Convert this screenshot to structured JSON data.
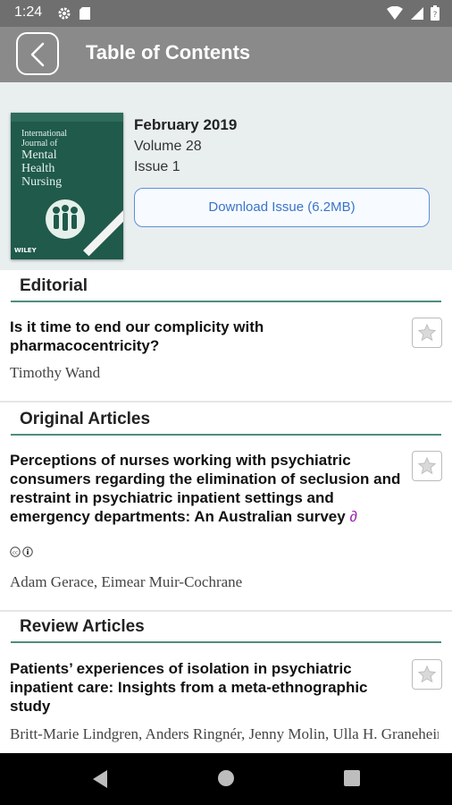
{
  "status_bar": {
    "time": "1:24",
    "left_icons": [
      "gear-icon",
      "sd-card-icon"
    ],
    "right_icons": [
      "wifi-icon",
      "signal-icon",
      "battery-icon"
    ]
  },
  "app_bar": {
    "title": "Table of Contents",
    "back_icon": "chevron-left-icon"
  },
  "issue": {
    "date": "February 2019",
    "volume": "Volume 28",
    "issue": "Issue 1",
    "download_label": "Download Issue (6.2MB)",
    "cover": {
      "line1": "International",
      "line2": "Journal of",
      "line3": "Mental",
      "line4": "Health",
      "line5": "Nursing",
      "publisher": "WILEY"
    }
  },
  "sections": [
    {
      "title": "Editorial",
      "articles": [
        {
          "title": "Is it time to end our complicity with pharmacocentricity?",
          "authors": "Timothy Wand",
          "open_access": false
        }
      ]
    },
    {
      "title": "Original Articles",
      "articles": [
        {
          "title": "Perceptions of nurses working with psychiatric consumers regarding the elimination of seclusion and restraint in psychiatric inpatient settings and emergency departments: An Australian survey",
          "authors": "Adam Gerace, Eimear Muir-Cochrane",
          "open_access": true
        }
      ]
    },
    {
      "title": "Review Articles",
      "articles": [
        {
          "title": "Patients’ experiences of isolation in psychiatric inpatient care: Insights from a meta-ethnographic study",
          "authors": "Britt-Marie Lindgren, Anders Ringnér, Jenny Molin, Ulla H. Graneheim",
          "open_access": false
        }
      ]
    }
  ],
  "colors": {
    "status_bar": "#6f6f6f",
    "app_bar": "#8a8a8a",
    "header_bg": "#e9eeef",
    "section_rule": "#4d8d7e",
    "download_border": "#5d8fd9",
    "open_access": "#9c27b0"
  },
  "nav_bar": {
    "icons": [
      "back-triangle-icon",
      "home-circle-icon",
      "recents-square-icon"
    ]
  }
}
